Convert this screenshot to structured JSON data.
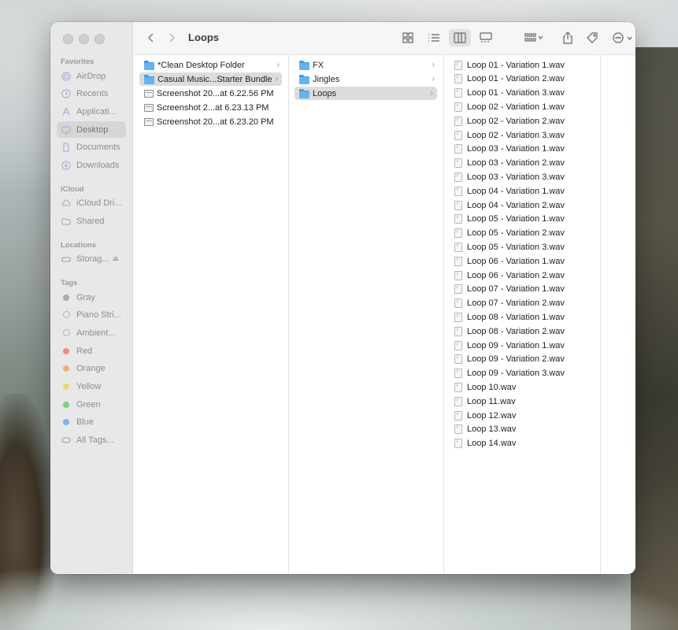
{
  "window": {
    "title": "Loops"
  },
  "sidebar": {
    "favorites_header": "Favorites",
    "favorites": [
      "AirDrop",
      "Recents",
      "Applicati...",
      "Desktop",
      "Documents",
      "Downloads"
    ],
    "icloud_header": "iCloud",
    "icloud": [
      "iCloud Dri...",
      "Shared"
    ],
    "locations_header": "Locations",
    "locations": [
      "Storag..."
    ],
    "tags_header": "Tags",
    "tags": [
      {
        "label": "Gray",
        "color": "#aaaaaa"
      },
      {
        "label": "Piano Stri...",
        "color": ""
      },
      {
        "label": "Ambient...",
        "color": ""
      },
      {
        "label": "Red",
        "color": "#f08a86"
      },
      {
        "label": "Orange",
        "color": "#f4b36a"
      },
      {
        "label": "Yellow",
        "color": "#f4d76b"
      },
      {
        "label": "Green",
        "color": "#7fd17f"
      },
      {
        "label": "Blue",
        "color": "#7fb2f2"
      },
      {
        "label": "All Tags...",
        "color": ""
      }
    ]
  },
  "columns": {
    "col1": [
      {
        "label": "*Clean Desktop Folder",
        "type": "folder"
      },
      {
        "label": "Casual Music...Starter Bundle",
        "type": "folder"
      },
      {
        "label": "Screenshot 20...at 6.22.56 PM",
        "type": "screenshot"
      },
      {
        "label": "Screenshot 2...at 6.23.13 PM",
        "type": "screenshot"
      },
      {
        "label": "Screenshot 20...at 6.23.20 PM",
        "type": "screenshot"
      }
    ],
    "col2": [
      {
        "label": "FX",
        "type": "folder"
      },
      {
        "label": "Jingles",
        "type": "folder"
      },
      {
        "label": "Loops",
        "type": "folder"
      }
    ],
    "col3": [
      "Loop 01 - Variation 1.wav",
      "Loop 01 - Variation 2.wav",
      "Loop 01 - Variation 3.wav",
      "Loop 02 - Variation 1.wav",
      "Loop 02 - Variation 2.wav",
      "Loop 02 - Variation 3.wav",
      "Loop 03 - Variation 1.wav",
      "Loop 03 - Variation 2.wav",
      "Loop 03 - Variation 3.wav",
      "Loop 04 - Variation 1.wav",
      "Loop 04 - Variation 2.wav",
      "Loop 05 - Variation 1.wav",
      "Loop 05 - Variation 2.wav",
      "Loop 05 - Variation 3.wav",
      "Loop 06 - Variation 1.wav",
      "Loop 06 - Variation 2.wav",
      "Loop 07 - Variation 1.wav",
      "Loop 07 - Variation 2.wav",
      "Loop 08 - Variation 1.wav",
      "Loop 08 - Variation 2.wav",
      "Loop 09 - Variation 1.wav",
      "Loop 09 - Variation 2.wav",
      "Loop 09 - Variation 3.wav",
      "Loop 10.wav",
      "Loop 11.wav",
      "Loop 12.wav",
      "Loop 13.wav",
      "Loop 14.wav"
    ]
  }
}
